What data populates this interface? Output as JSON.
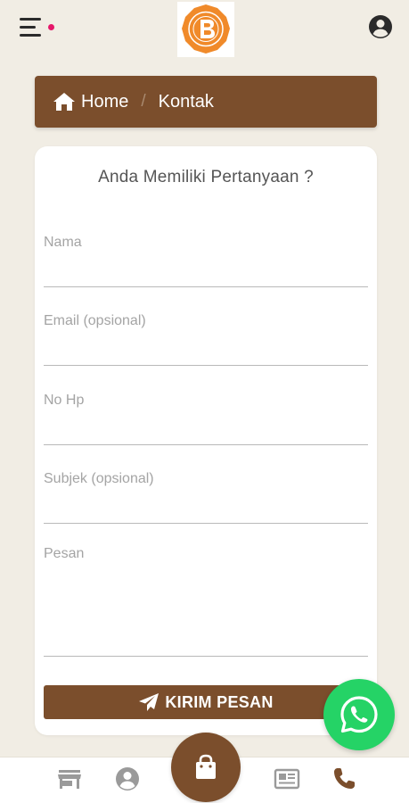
{
  "header": {
    "logo_alt": "logo",
    "icons": {
      "menu": "hamburger-menu-icon",
      "account": "account-circle-icon"
    },
    "notification_dot_color": "#e6176a"
  },
  "breadcrumb": {
    "home_label": "Home",
    "separator": "/",
    "current_label": "Kontak"
  },
  "form": {
    "title": "Anda Memiliki Pertanyaan ?",
    "fields": {
      "nama": {
        "label": "Nama",
        "value": ""
      },
      "email": {
        "label": "Email (opsional)",
        "value": ""
      },
      "hp": {
        "label": "No Hp",
        "value": ""
      },
      "subjek": {
        "label": "Subjek (opsional)",
        "value": ""
      },
      "pesan": {
        "label": "Pesan",
        "value": ""
      }
    },
    "submit_label": "KIRIM PESAN"
  },
  "colors": {
    "brand_brown": "#7b4e2c",
    "background": "#f1ede4",
    "whatsapp_green": "#25d366"
  },
  "bottom_nav": {
    "items": [
      "store-icon",
      "account-icon",
      "shopping-bag-icon",
      "newspaper-icon",
      "phone-icon"
    ]
  }
}
